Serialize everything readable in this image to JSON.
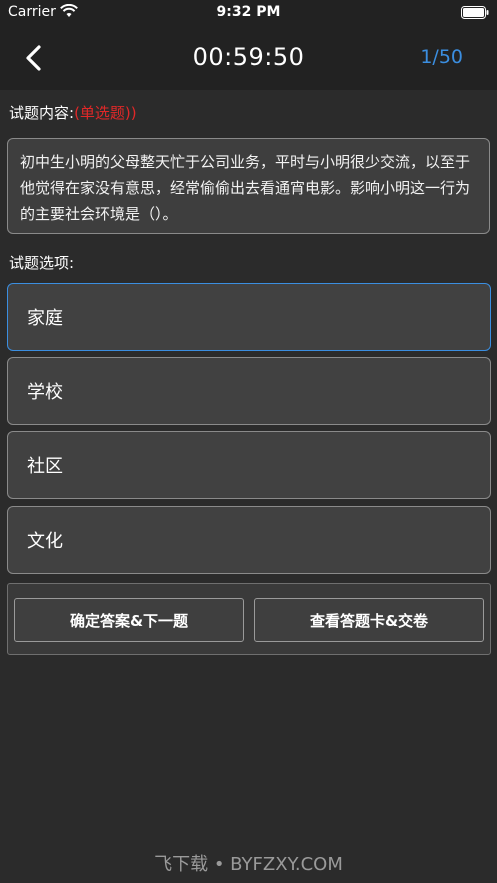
{
  "status_bar": {
    "carrier": "Carrier",
    "time": "9:32 PM"
  },
  "nav": {
    "timer": "00:59:50",
    "progress": "1/50",
    "accent_color": "#3b8ee0"
  },
  "question": {
    "label": "试题内容:",
    "type": "(单选题))",
    "text": "初中生小明的父母整天忙于公司业务，平时与小明很少交流，以至于他觉得在家没有意思，经常偷偷出去看通宵电影。影响小明这一行为的主要社会环境是（）。"
  },
  "options": {
    "label": "试题选项:",
    "items": [
      {
        "text": "家庭",
        "selected": true
      },
      {
        "text": "学校",
        "selected": false
      },
      {
        "text": "社区",
        "selected": false
      },
      {
        "text": "文化",
        "selected": false
      }
    ]
  },
  "actions": {
    "next_label": "确定答案&下一题",
    "card_label": "查看答题卡&交卷"
  },
  "watermark": "飞下载 • BYFZXY.COM"
}
